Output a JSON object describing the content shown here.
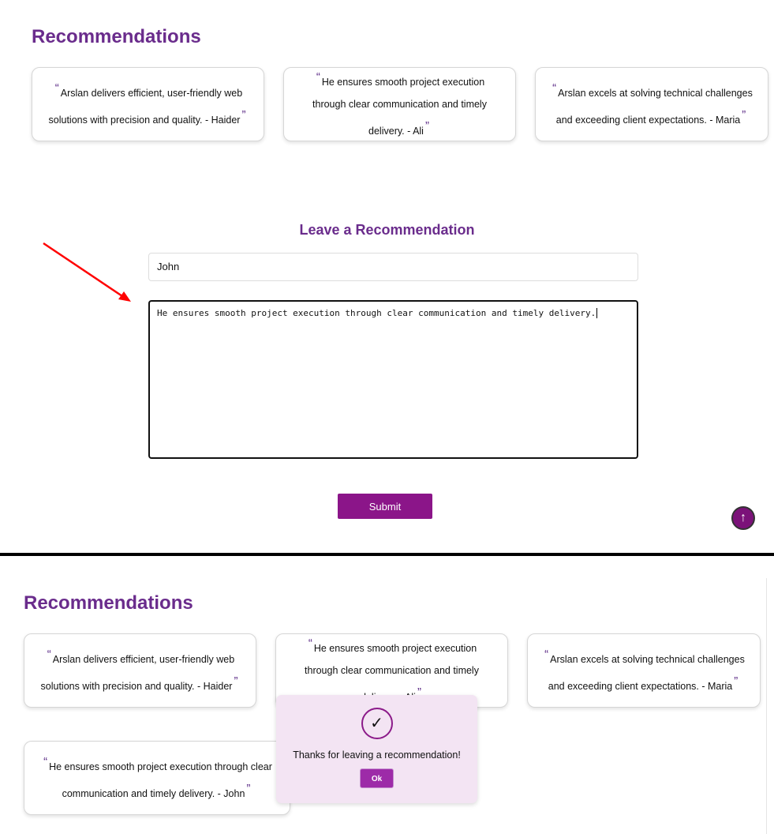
{
  "top": {
    "heading": "Recommendations",
    "cards": [
      {
        "text": "Arslan delivers efficient, user-friendly web solutions with precision and quality. - Haider"
      },
      {
        "text": "He ensures smooth project execution through clear communication and timely delivery. - Ali"
      },
      {
        "text": "Arslan excels at solving technical challenges and exceeding client expectations. - Maria"
      }
    ],
    "form": {
      "title": "Leave a Recommendation",
      "name_value": "John",
      "message_value": "He ensures smooth project execution through clear communication and timely delivery.",
      "submit_label": "Submit"
    },
    "scroll_top_icon": "↑"
  },
  "bottom": {
    "heading": "Recommendations",
    "cards": [
      {
        "text": "Arslan delivers efficient, user-friendly web solutions with precision and quality. - Haider"
      },
      {
        "text": "He ensures smooth project execution through clear communication and timely delivery. - Ali"
      },
      {
        "text": "Arslan excels at solving technical challenges and exceeding client expectations. - Maria"
      },
      {
        "text": "He ensures smooth project execution through clear communication and timely delivery. - John"
      }
    ],
    "popup": {
      "icon": "✓",
      "message": "Thanks for leaving a recommendation!",
      "ok_label": "Ok"
    }
  },
  "quote_open": "“",
  "quote_close": "”",
  "colors": {
    "accent": "#6a2c8c",
    "button": "#8b1589",
    "annotation_arrow": "#ff0000"
  }
}
